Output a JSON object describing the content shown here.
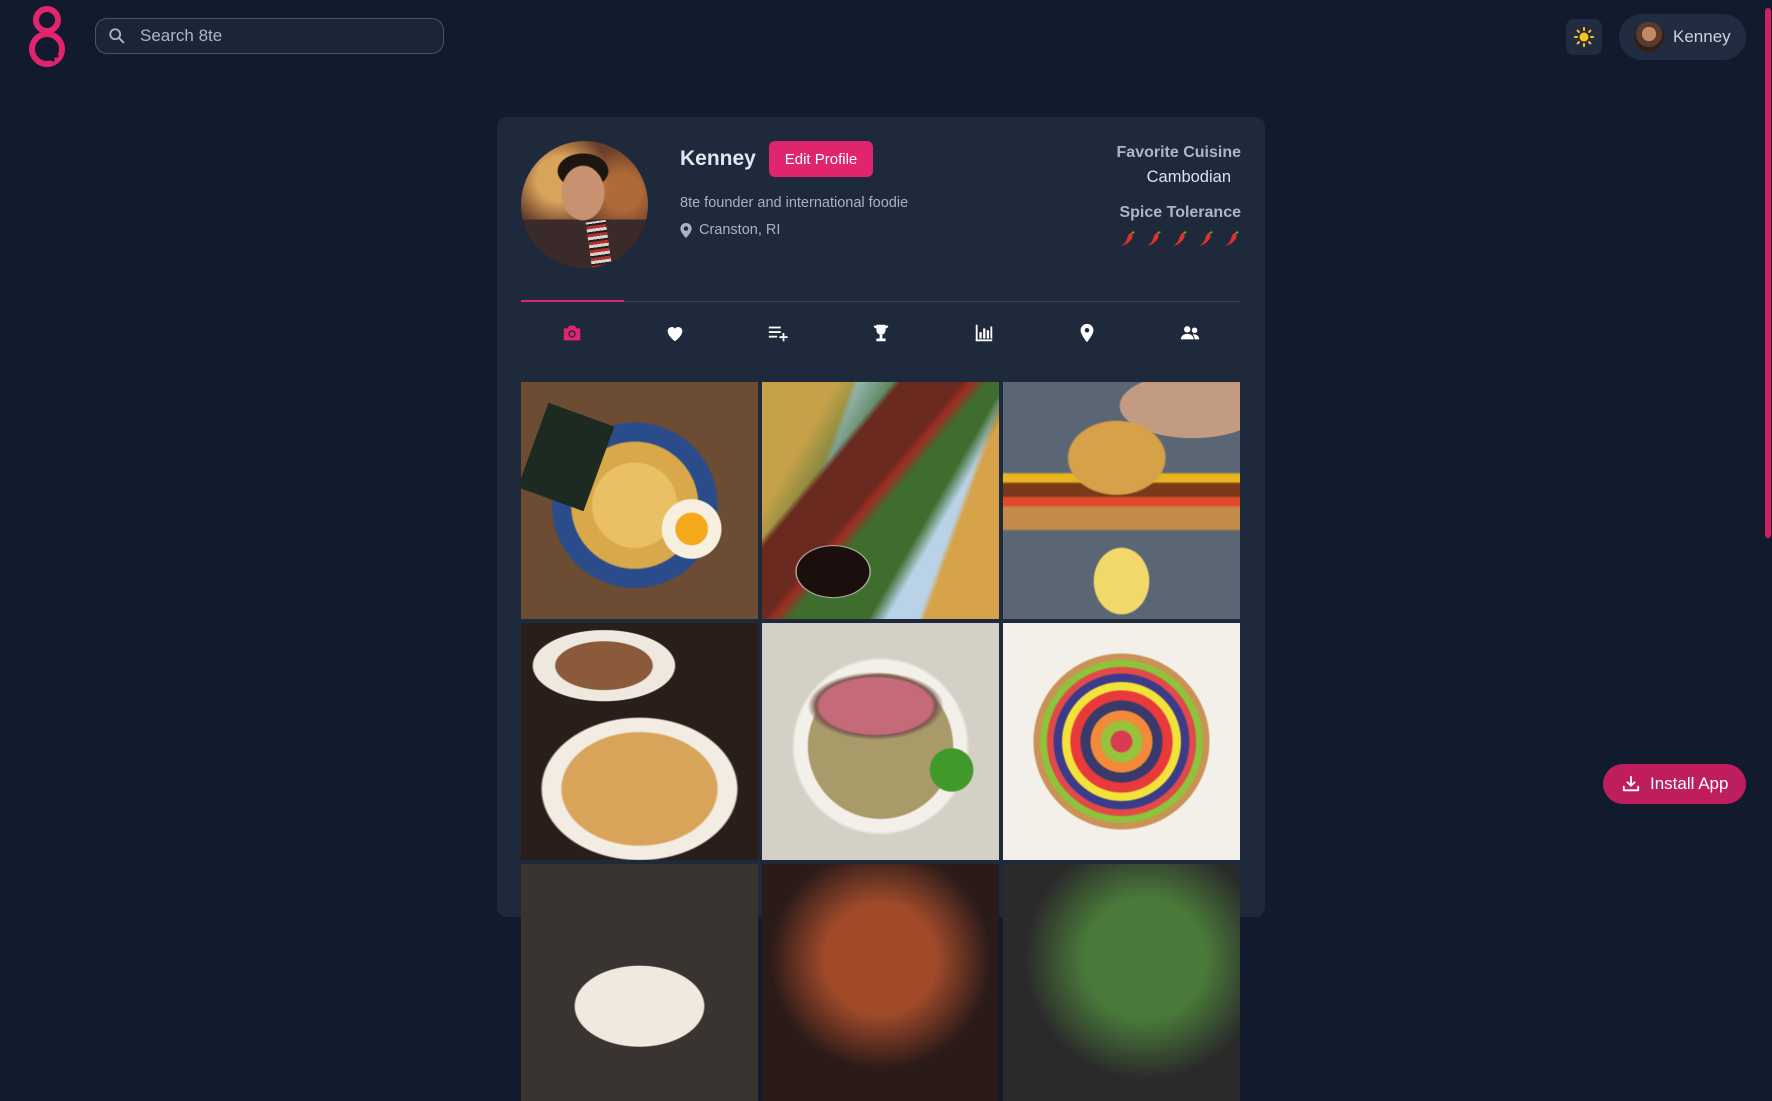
{
  "app": {
    "logo_icon": "8te-logo-icon",
    "accent": "#e0246d"
  },
  "search": {
    "placeholder": "Search 8te"
  },
  "header": {
    "theme_icon": "sun-icon",
    "user_name": "Kenney"
  },
  "profile": {
    "name": "Kenney",
    "edit_label": "Edit Profile",
    "bio": "8te founder and international foodie",
    "location": "Cranston, RI",
    "favorite_cuisine_label": "Favorite Cuisine",
    "favorite_cuisine": "Cambodian",
    "spice_label": "Spice Tolerance",
    "spice_level": 5,
    "spice_max": 5
  },
  "tabs": [
    {
      "icon": "camera-icon",
      "active": true
    },
    {
      "icon": "heart-icon",
      "active": false
    },
    {
      "icon": "playlist-add-icon",
      "active": false
    },
    {
      "icon": "trophy-icon",
      "active": false
    },
    {
      "icon": "bar-chart-icon",
      "active": false
    },
    {
      "icon": "map-pin-icon",
      "active": false
    },
    {
      "icon": "users-icon",
      "active": false
    }
  ],
  "photos": [
    "ramen",
    "steak-skewer",
    "cheeseburger-fries",
    "pasta",
    "pho",
    "fruit-tart",
    "dish-7",
    "dish-8",
    "dish-9"
  ],
  "install": {
    "label": "Install App"
  }
}
